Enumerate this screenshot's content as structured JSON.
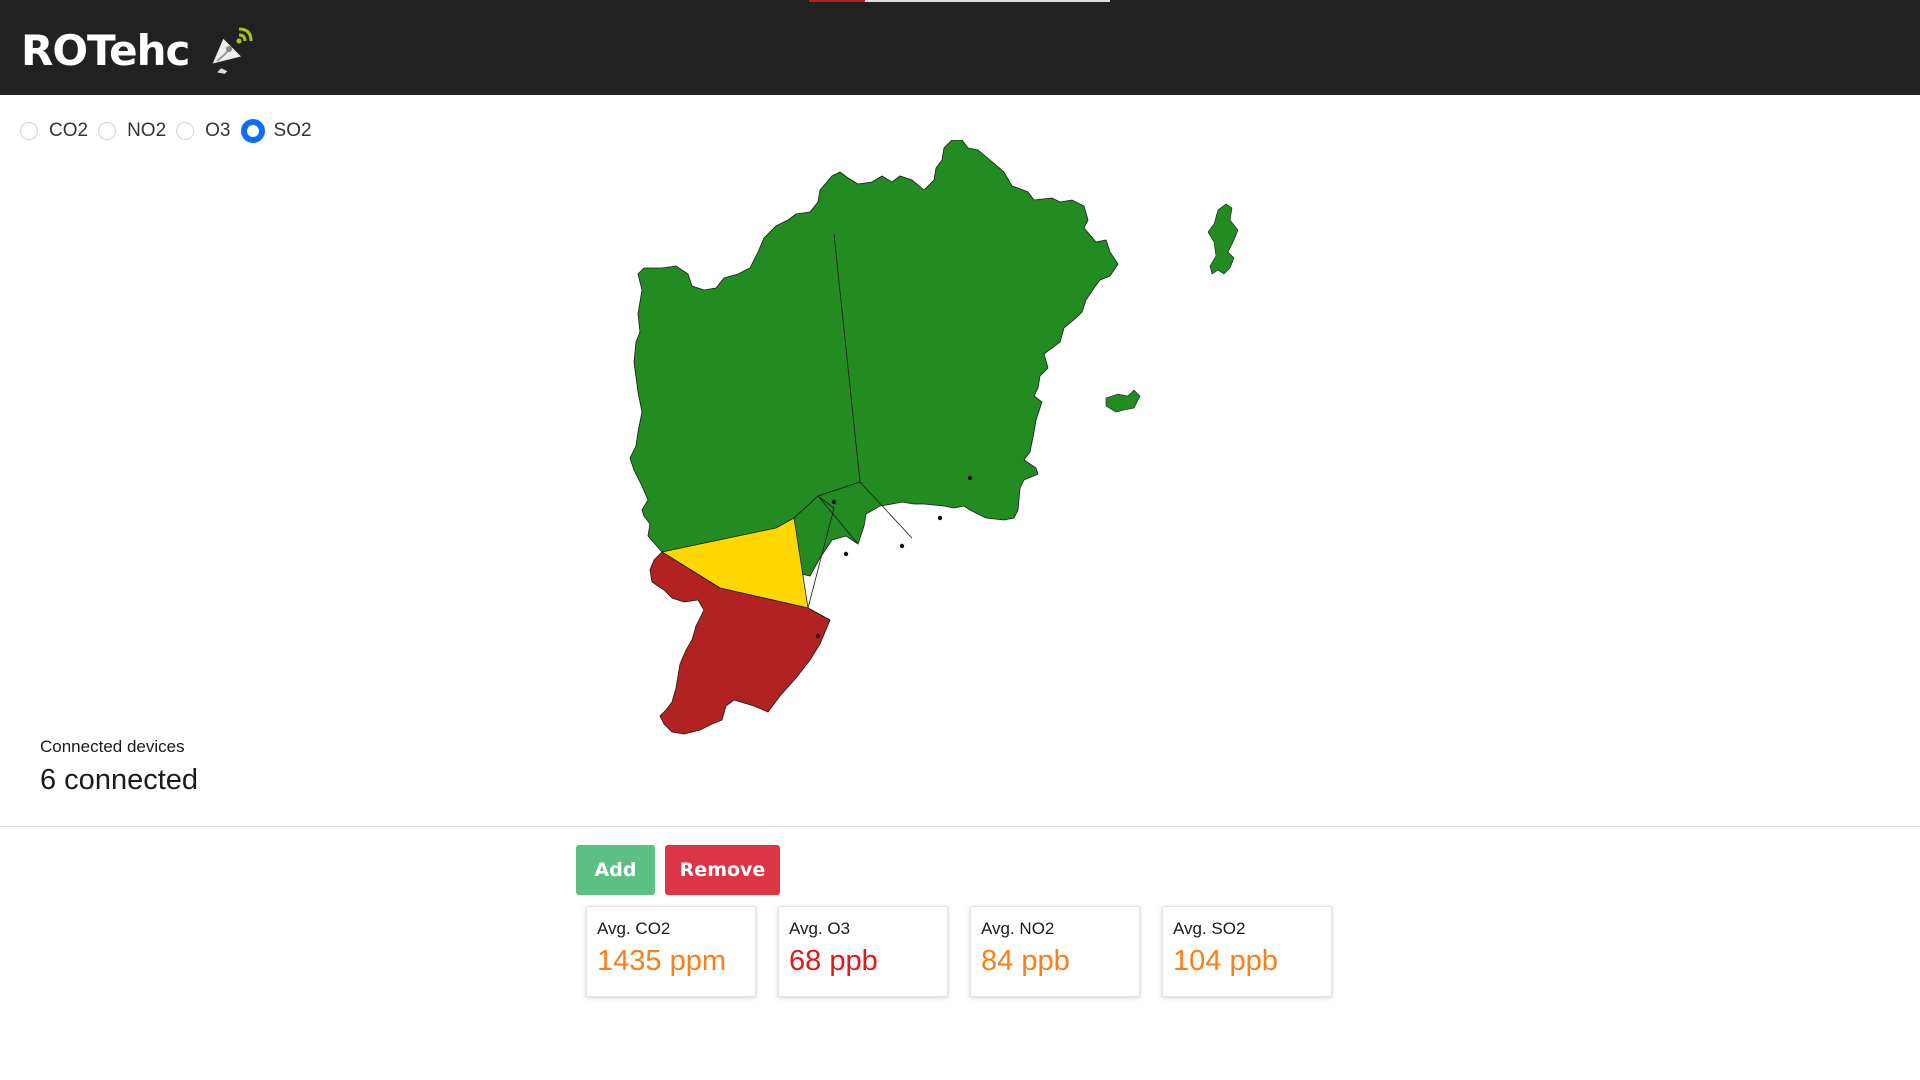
{
  "header": {
    "title": "ROTehc",
    "icon": "satellite-dish-icon"
  },
  "pollutants": {
    "options": [
      {
        "label": "CO2",
        "checked": false
      },
      {
        "label": "NO2",
        "checked": false
      },
      {
        "label": "O3",
        "checked": false
      },
      {
        "label": "SO2",
        "checked": true
      }
    ],
    "selected": "SO2"
  },
  "map": {
    "region_colors": {
      "good": "#228b22",
      "moderate": "#ffd700",
      "bad": "#b22222"
    },
    "device_markers": 7
  },
  "devices": {
    "label": "Connected devices",
    "value": "6 connected"
  },
  "actions": {
    "add_label": "Add",
    "remove_label": "Remove"
  },
  "stats": [
    {
      "title": "Avg. CO2",
      "value": "1435 ppm",
      "level": "warning"
    },
    {
      "title": "Avg. O3",
      "value": "68 ppb",
      "level": "danger"
    },
    {
      "title": "Avg. NO2",
      "value": "84 ppb",
      "level": "warning"
    },
    {
      "title": "Avg. SO2",
      "value": "104 ppb",
      "level": "warning"
    }
  ],
  "colors": {
    "header_bg": "#212121",
    "add_button": "#5cbf83",
    "remove_button": "#dc3545",
    "warning_text": "#fd7e14",
    "danger_text": "#e8151b",
    "radio_checked": "#0d6efd"
  }
}
